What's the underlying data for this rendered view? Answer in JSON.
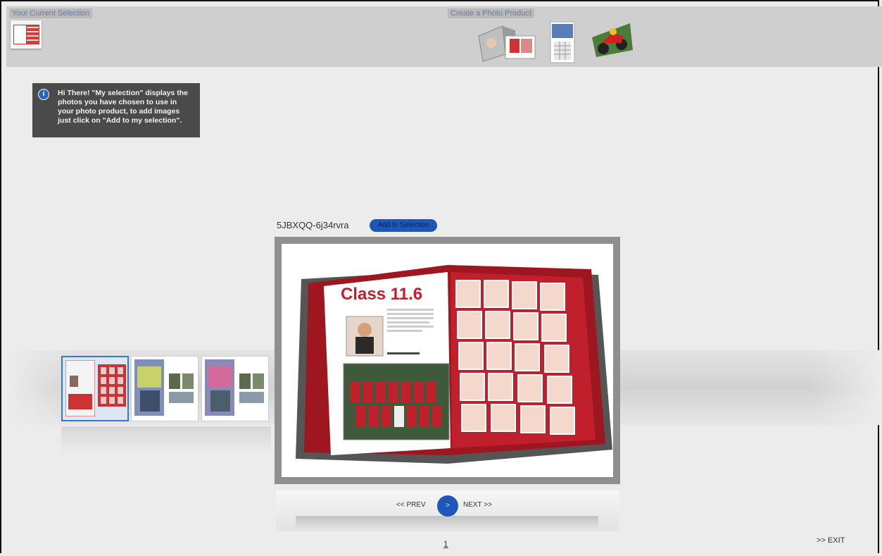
{
  "header": {
    "current_selection_label": "Your Current Selection",
    "create_product_label": "Create a Photo Product"
  },
  "products": [
    {
      "icon": "photobook-icon"
    },
    {
      "icon": "calendar-icon"
    },
    {
      "icon": "motorbike-icon"
    }
  ],
  "tooltip": {
    "text": "Hi There!  \"My selection\" displays the photos you have chosen to use in your photo product, to add images just click on \"Add to my selection\"."
  },
  "viewer": {
    "image_id": "5JBXQQ-6j34rvra",
    "add_button": "Add to Selection",
    "book": {
      "title": "Class 11.6"
    }
  },
  "navigation": {
    "prev": "<< PREV",
    "play": ">",
    "next": "NEXT >>",
    "page": "1",
    "exit": ">> EXIT"
  },
  "colors": {
    "accent": "#1e57b8",
    "book_red": "#c0202c",
    "topbar": "#cfcfcf",
    "tooltip_bg": "#4a4a4a"
  }
}
